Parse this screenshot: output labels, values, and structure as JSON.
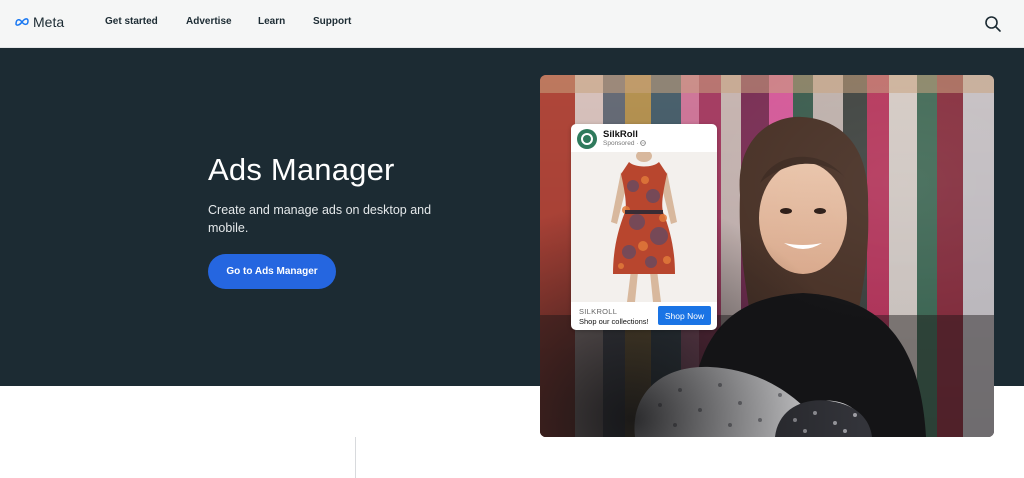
{
  "nav": {
    "brand": "Meta",
    "links": [
      "Get started",
      "Advertise",
      "Learn",
      "Support"
    ]
  },
  "hero": {
    "title": "Ads Manager",
    "description": "Create and manage ads on desktop and mobile.",
    "cta_label": "Go to Ads Manager"
  },
  "ad": {
    "brand": "SilkRoll",
    "sponsored": "Sponsored ·",
    "footer_brand": "SILKROLL",
    "footer_tagline": "Shop our collections!",
    "cta_label": "Shop Now"
  },
  "colors": {
    "nav_bg": "#f5f6f6",
    "hero_bg": "#1c2b33",
    "cta_blue": "#2566e0",
    "shop_blue": "#1a74e5",
    "brand_green": "#2f7a5c"
  },
  "icons": {
    "logo": "meta-infinity-icon",
    "search": "search-icon",
    "avatar": "silkroll-logo-icon",
    "globe": "globe-icon"
  }
}
